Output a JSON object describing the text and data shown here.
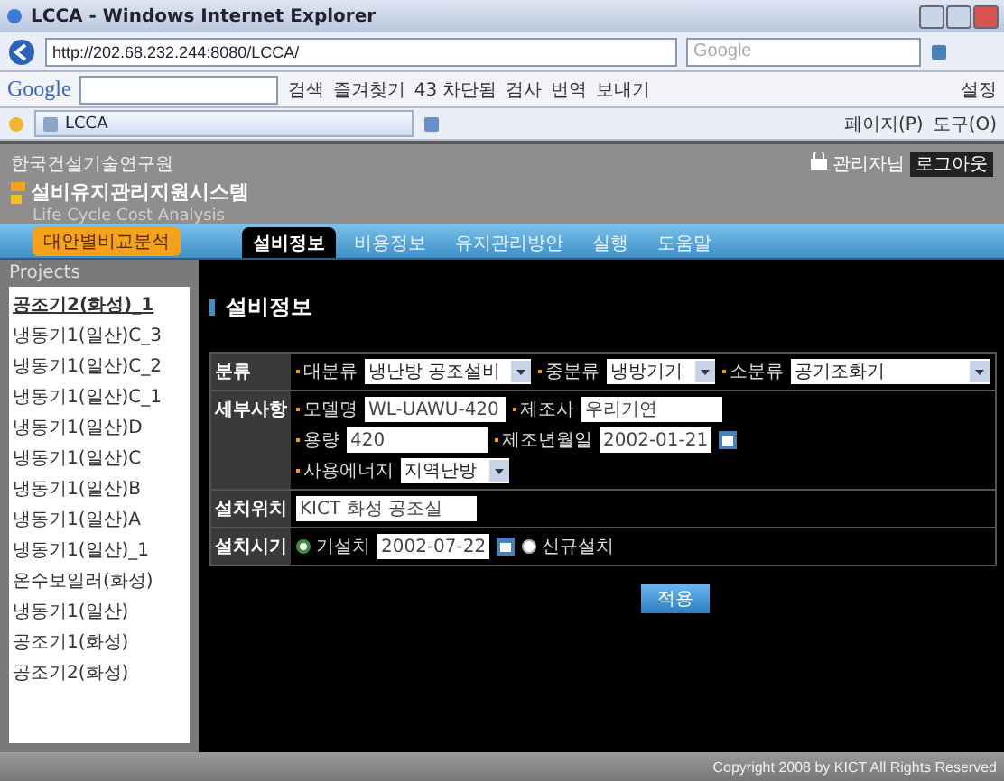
{
  "browser": {
    "title": "LCCA - Windows Internet Explorer",
    "address": "http://202.68.232.244:8080/LCCA/",
    "search_placeholder": "Google",
    "toolbar_brand": "Google",
    "toolbar_items": [
      "검색",
      "즐겨찾기",
      "43 차단됨",
      "검사",
      "번역",
      "보내기"
    ],
    "toolbar_settings": "설정",
    "tab": "LCCA",
    "commands": [
      "페이지(P)",
      "도구(O)"
    ]
  },
  "header": {
    "org": "한국건설기술연구원",
    "system_name": "설비유지관리지원시스템",
    "subtitle": "Life Cycle Cost Analysis",
    "user": "관리자님",
    "logout": "로그아웃"
  },
  "nav": {
    "compare_button": "대안별비교분석",
    "tabs": [
      {
        "label": "설비정보",
        "selected": true
      },
      {
        "label": "비용정보",
        "selected": false
      },
      {
        "label": "유지관리방안",
        "selected": false
      },
      {
        "label": "실행",
        "selected": false
      },
      {
        "label": "도움말",
        "selected": false
      }
    ]
  },
  "sidebar": {
    "title": "Projects",
    "items": [
      {
        "label": "공조기2(화성)_1",
        "selected": true
      },
      {
        "label": "냉동기1(일산)C_3",
        "selected": false
      },
      {
        "label": "냉동기1(일산)C_2",
        "selected": false
      },
      {
        "label": "냉동기1(일산)C_1",
        "selected": false
      },
      {
        "label": "냉동기1(일산)D",
        "selected": false
      },
      {
        "label": "냉동기1(일산)C",
        "selected": false
      },
      {
        "label": "냉동기1(일산)B",
        "selected": false
      },
      {
        "label": "냉동기1(일산)A",
        "selected": false
      },
      {
        "label": "냉동기1(일산)_1",
        "selected": false
      },
      {
        "label": "온수보일러(화성)",
        "selected": false
      },
      {
        "label": "냉동기1(일산)",
        "selected": false
      },
      {
        "label": "공조기1(화성)",
        "selected": false
      },
      {
        "label": "공조기2(화성)",
        "selected": false
      }
    ]
  },
  "main": {
    "heading": "설비정보",
    "rows": [
      {
        "label": "분류",
        "lines": [
          [
            {
              "kind": "select",
              "label": "대분류",
              "value": "냉난방 공조설비"
            },
            {
              "kind": "select",
              "label": "중분류",
              "value": "냉방기기"
            },
            {
              "kind": "select",
              "label": "소분류",
              "value": "공기조화기"
            }
          ]
        ]
      },
      {
        "label": "세부사항",
        "lines": [
          [
            {
              "kind": "input",
              "label": "모델명",
              "value": "WL-UAWU-420"
            },
            {
              "kind": "input",
              "label": "제조사",
              "value": "우리기연"
            }
          ],
          [
            {
              "kind": "input",
              "label": "용량",
              "value": "420"
            },
            {
              "kind": "date",
              "label": "제조년월일",
              "value": "2002-01-21"
            }
          ],
          [
            {
              "kind": "select",
              "label": "사용에너지",
              "value": "지역난방"
            }
          ]
        ]
      },
      {
        "label": "설치위치",
        "lines": [
          [
            {
              "kind": "input",
              "value": "KICT 화성 공조실"
            }
          ]
        ]
      },
      {
        "label": "설치시기",
        "lines": [
          [
            {
              "kind": "radio",
              "label": "기설치",
              "selected": true
            },
            {
              "kind": "date",
              "value": "2002-07-22"
            },
            {
              "kind": "radio",
              "label": "신규설치",
              "selected": false
            }
          ]
        ]
      }
    ],
    "apply": "적용"
  },
  "footer": "Copyright 2008 by KICT All Rights Reserved"
}
